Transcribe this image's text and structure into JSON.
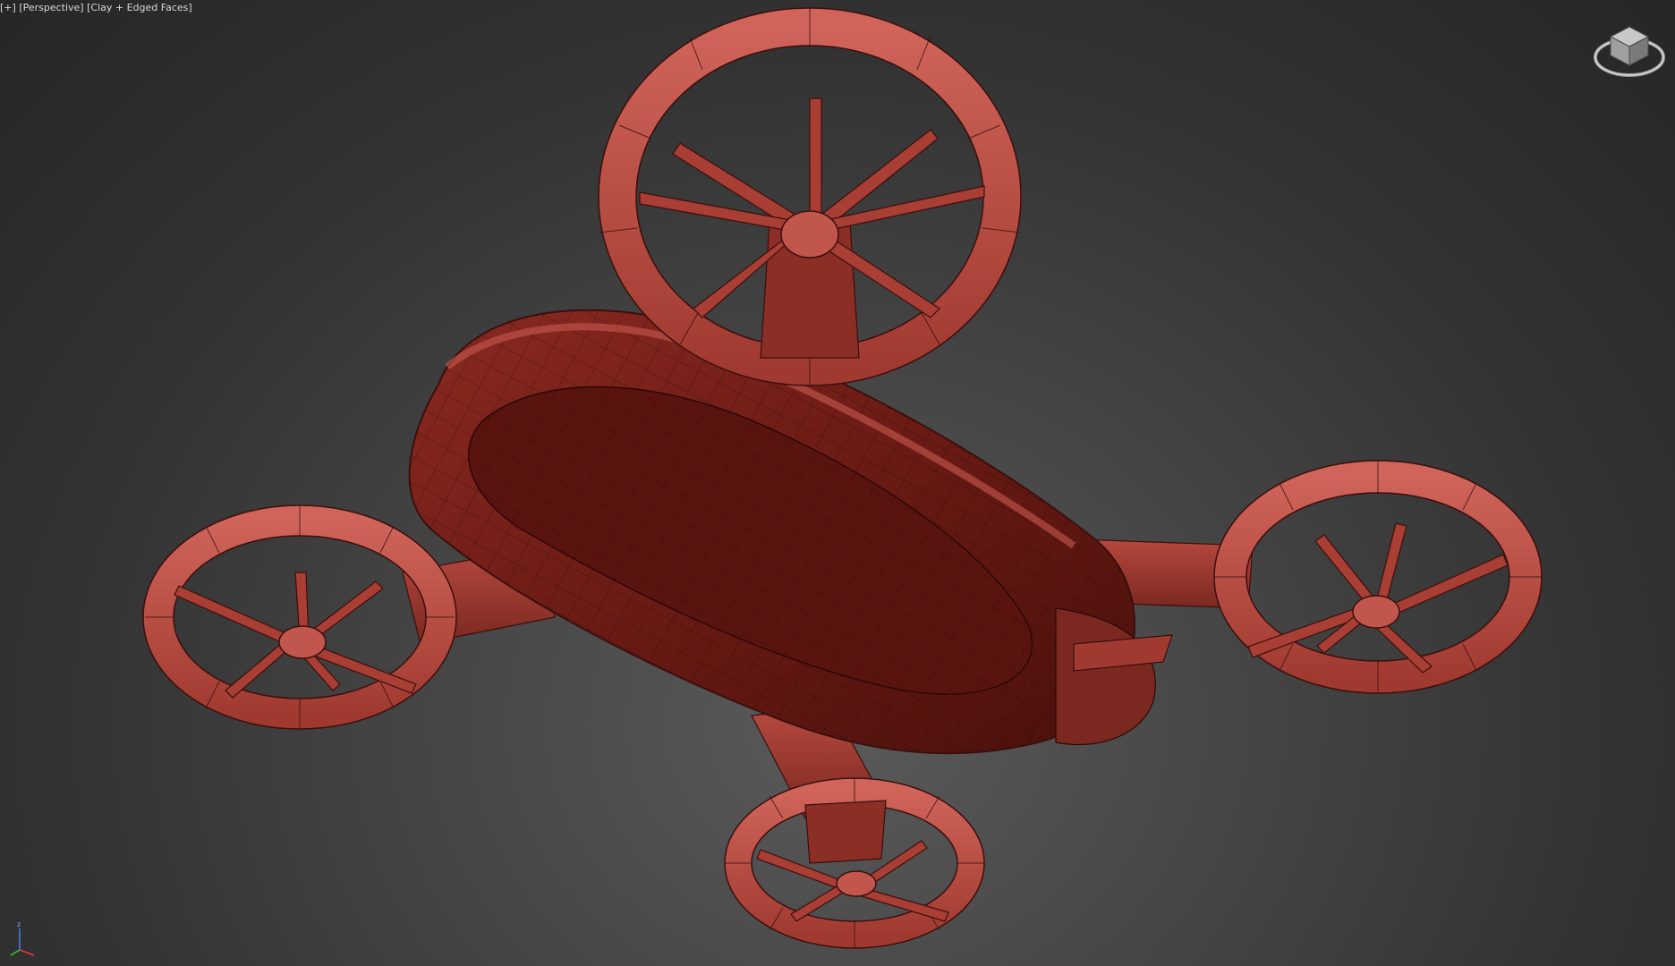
{
  "viewport": {
    "menu_label": "[+]",
    "view_label": "[Perspective]",
    "shading_label": "[Clay + Edged Faces]"
  },
  "scene": {
    "model": "drone",
    "material_color": "#b8483d",
    "edge_color": "#3a0f0c",
    "background_top": "#262626",
    "background_bottom": "#5a5a5a"
  },
  "axis_gizmo": {
    "z_label": "z"
  },
  "icons": {
    "viewcube": "viewcube-icon",
    "axis": "axis-tripod-icon"
  }
}
